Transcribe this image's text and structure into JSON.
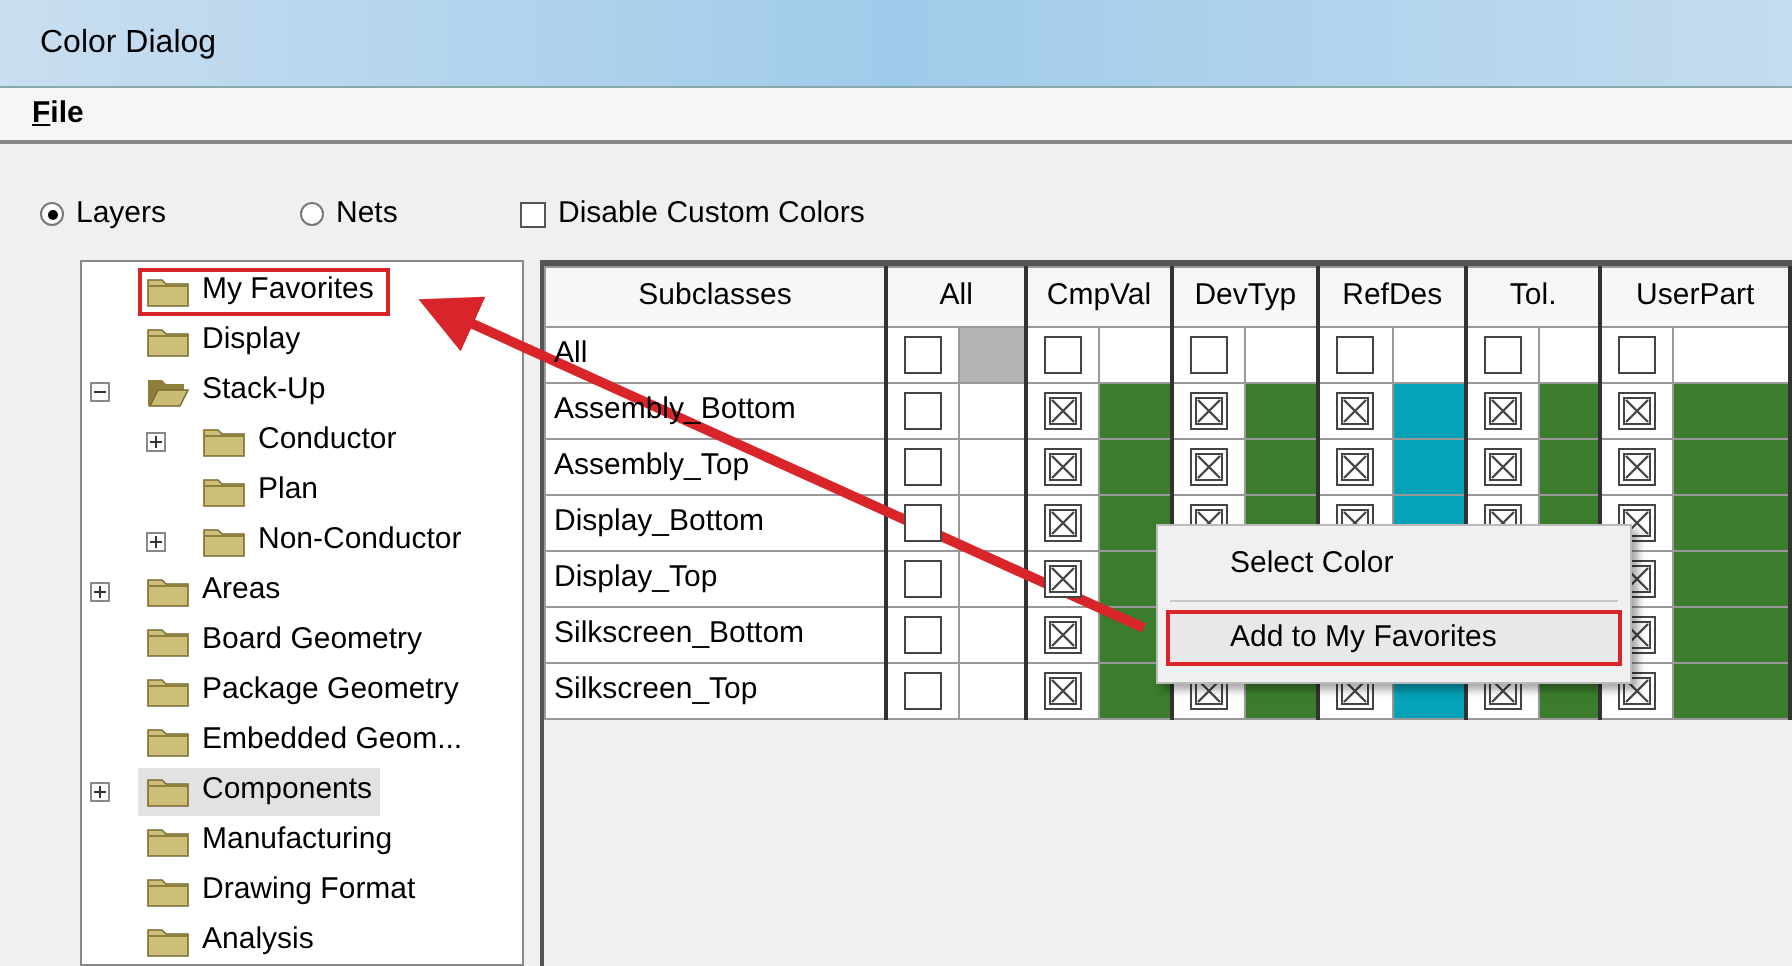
{
  "window": {
    "title": "Color Dialog"
  },
  "menu": [
    {
      "label": "File"
    }
  ],
  "options": [
    {
      "kind": "radio",
      "label": "Layers",
      "selected": true
    },
    {
      "kind": "radio",
      "label": "Nets",
      "selected": false
    },
    {
      "kind": "checkbox",
      "label": "Disable Custom Colors",
      "checked": false
    }
  ],
  "tree": [
    {
      "label": "My Favorites",
      "selected": false,
      "highlighted": true
    },
    {
      "label": "Display",
      "selected": false
    },
    {
      "label": "Stack-Up",
      "selected": false,
      "expanded": true,
      "children": [
        {
          "label": "Conductor",
          "selected": false,
          "expanded": false
        },
        {
          "label": "Plan",
          "selected": false
        },
        {
          "label": "Non-Conductor",
          "selected": false,
          "expanded": false
        }
      ]
    },
    {
      "label": "Areas",
      "selected": false,
      "expanded": false
    },
    {
      "label": "Board Geometry",
      "selected": false
    },
    {
      "label": "Package Geometry",
      "selected": false
    },
    {
      "label": "Embedded Geom...",
      "selected": false
    },
    {
      "label": "Components",
      "selected": true,
      "expanded": false
    },
    {
      "label": "Manufacturing",
      "selected": false
    },
    {
      "label": "Drawing Format",
      "selected": false
    },
    {
      "label": "Analysis",
      "selected": false
    }
  ],
  "grid": {
    "columns": [
      "Subclasses",
      "All",
      "CmpVal",
      "DevTyp",
      "RefDes",
      "Tol.",
      "UserPart"
    ],
    "rows": [
      {
        "name": "All",
        "cells": [
          {
            "checked": false,
            "color": "#b3b3b3"
          },
          {
            "checked": false
          },
          {
            "checked": false
          },
          {
            "checked": false
          },
          {
            "checked": false
          },
          {
            "checked": false
          }
        ]
      },
      {
        "name": "Assembly_Bottom",
        "cells": [
          {
            "checked": false
          },
          {
            "checked": true,
            "color": "#3b7d2c"
          },
          {
            "checked": true,
            "color": "#3b7d2c"
          },
          {
            "checked": true,
            "color": "#06a2b8"
          },
          {
            "checked": true,
            "color": "#3b7d2c"
          },
          {
            "checked": true,
            "color": "#3b7d2c"
          }
        ]
      },
      {
        "name": "Assembly_Top",
        "cells": [
          {
            "checked": false
          },
          {
            "checked": true,
            "color": "#3b7d2c"
          },
          {
            "checked": true,
            "color": "#3b7d2c"
          },
          {
            "checked": true,
            "color": "#06a2b8"
          },
          {
            "checked": true,
            "color": "#3b7d2c"
          },
          {
            "checked": true,
            "color": "#3b7d2c"
          }
        ]
      },
      {
        "name": "Display_Bottom",
        "cells": [
          {
            "checked": false
          },
          {
            "checked": true,
            "color": "#3b7d2c"
          },
          {
            "checked": true,
            "color": "#3b7d2c"
          },
          {
            "checked": true,
            "color": "#06a2b8"
          },
          {
            "checked": true,
            "color": "#3b7d2c"
          },
          {
            "checked": true,
            "color": "#3b7d2c"
          }
        ]
      },
      {
        "name": "Display_Top",
        "cells": [
          {
            "checked": false
          },
          {
            "checked": true,
            "color": "#3b7d2c"
          },
          null,
          null,
          null,
          {
            "checked": true,
            "color": "#3b7d2c"
          }
        ]
      },
      {
        "name": "Silkscreen_Bottom",
        "cells": [
          {
            "checked": false
          },
          {
            "checked": true,
            "color": "#3b7d2c"
          },
          null,
          null,
          null,
          {
            "checked": true,
            "color": "#3b7d2c"
          }
        ]
      },
      {
        "name": "Silkscreen_Top",
        "cells": [
          {
            "checked": false
          },
          {
            "checked": true,
            "color": "#3b7d2c"
          },
          {
            "checked": true,
            "color": "#3b7d2c"
          },
          {
            "checked": true,
            "color": "#06a2b8"
          },
          {
            "checked": true,
            "color": "#3b7d2c"
          },
          {
            "checked": true,
            "color": "#3b7d2c"
          }
        ]
      }
    ]
  },
  "context_menu": {
    "items": [
      {
        "label": "Select Color",
        "highlighted": false
      },
      {
        "label": "Add to My Favorites",
        "highlighted": true
      }
    ]
  }
}
